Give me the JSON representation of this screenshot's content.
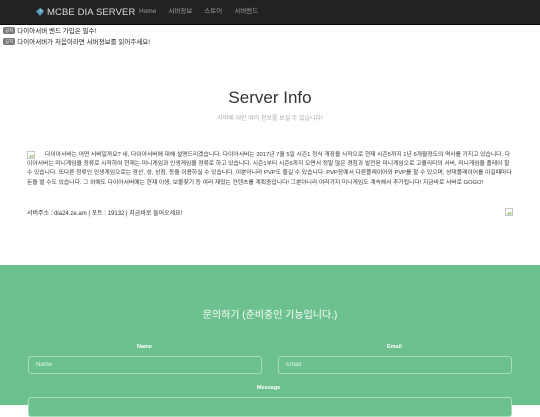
{
  "nav": {
    "brand": "MCBE DIA SERVER",
    "links": [
      "Home",
      "서버정보",
      "스토어",
      "서버밴드"
    ]
  },
  "notices": [
    {
      "badge": "공지",
      "text": "다이아서버 밴드 가입은 필수!"
    },
    {
      "badge": "공지",
      "text": "다이아서버가 처음이라면 서버정보를 읽어주세요!"
    }
  ],
  "info": {
    "title": "Server Info",
    "subtitle": "서버에 대한 여러 정보를 보실 수 있습니다!",
    "description": "다이아서버는 어떤 서버일까요? 네, 다이아서버에 대해 설명드리겠습니다. 다이아서버는 2017년 7월 5일 시즌1 정식 개장을 시작으로 현재 시즌5까지 1년 6개월정도의 역사를 가지고 있습니다. 다이아서버는 미니게임을 정류로 시작하여 현재는 미니게임과 인생게임을 정류로 하고 있습니다. 시즌1부터 시즌5까지 오면서 정말 많은 경험과 발전된 미니게임으로 고퀄리티의 서버, 미니게임을 플레이 할 수 있습니다. 또다른 정류인 인생게임으로는 광산, 섬, 상점, 등을 이용하실 수 있습니다. 이뿐아니라 PVP도 즐길 수 있습니다. PVP장에서 다른플레이어와 PVP를 할 수 있으며, 상대플레이어를 이길때마다 돈을 벌 수도 있습니다. 그 외에도 다이아서버에는 현재 이생, 보물찾기 등 여러 재밌는 컨텐츠를 계획중입니다! 그뿐아니라 여러가지 미니게임도 계속해서 추가됩니다! 지금바로 서버로 GOGO!",
    "server_address": "서버주소 : dia24.ze.am | 포트 : 19132 | 지금바로 들어오세요!"
  },
  "contact": {
    "title": "문의하기 (준비중인 기능입니다.)",
    "name_label": "Name",
    "name_placeholder": "Name",
    "email_label": "Email",
    "email_placeholder": "Email",
    "message_label": "Message"
  },
  "colors": {
    "navbar": "#222222",
    "contact_bg": "#6cc18e"
  }
}
